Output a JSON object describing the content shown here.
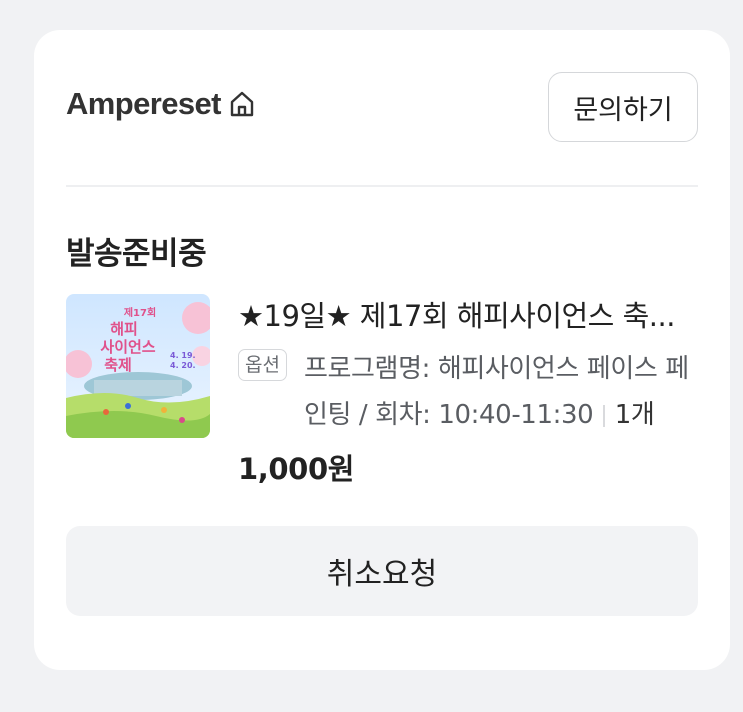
{
  "header": {
    "brand": "Ampereset",
    "brand_icon": "home-icon",
    "inquiry_label": "문의하기"
  },
  "order": {
    "status": "발송준비중",
    "item": {
      "title": "★19일★ 제17회 해피사이언스 축...",
      "option_badge": "옵션",
      "option_line1": "프로그램명: 해피사이언스 페이스 페",
      "option_line2": "인팅 / 회차: 10:40-11:30",
      "quantity": "1개",
      "price": "1,000원",
      "thumbnail": {
        "line1": "제17회",
        "line2": "해피",
        "line3": "사이언스",
        "line4": "축제",
        "date1": "4. 19.",
        "date2": "4. 20."
      }
    },
    "cancel_label": "취소요청"
  },
  "colors": {
    "background": "#f1f2f4",
    "card": "#ffffff",
    "button_gray": "#f2f3f5"
  }
}
